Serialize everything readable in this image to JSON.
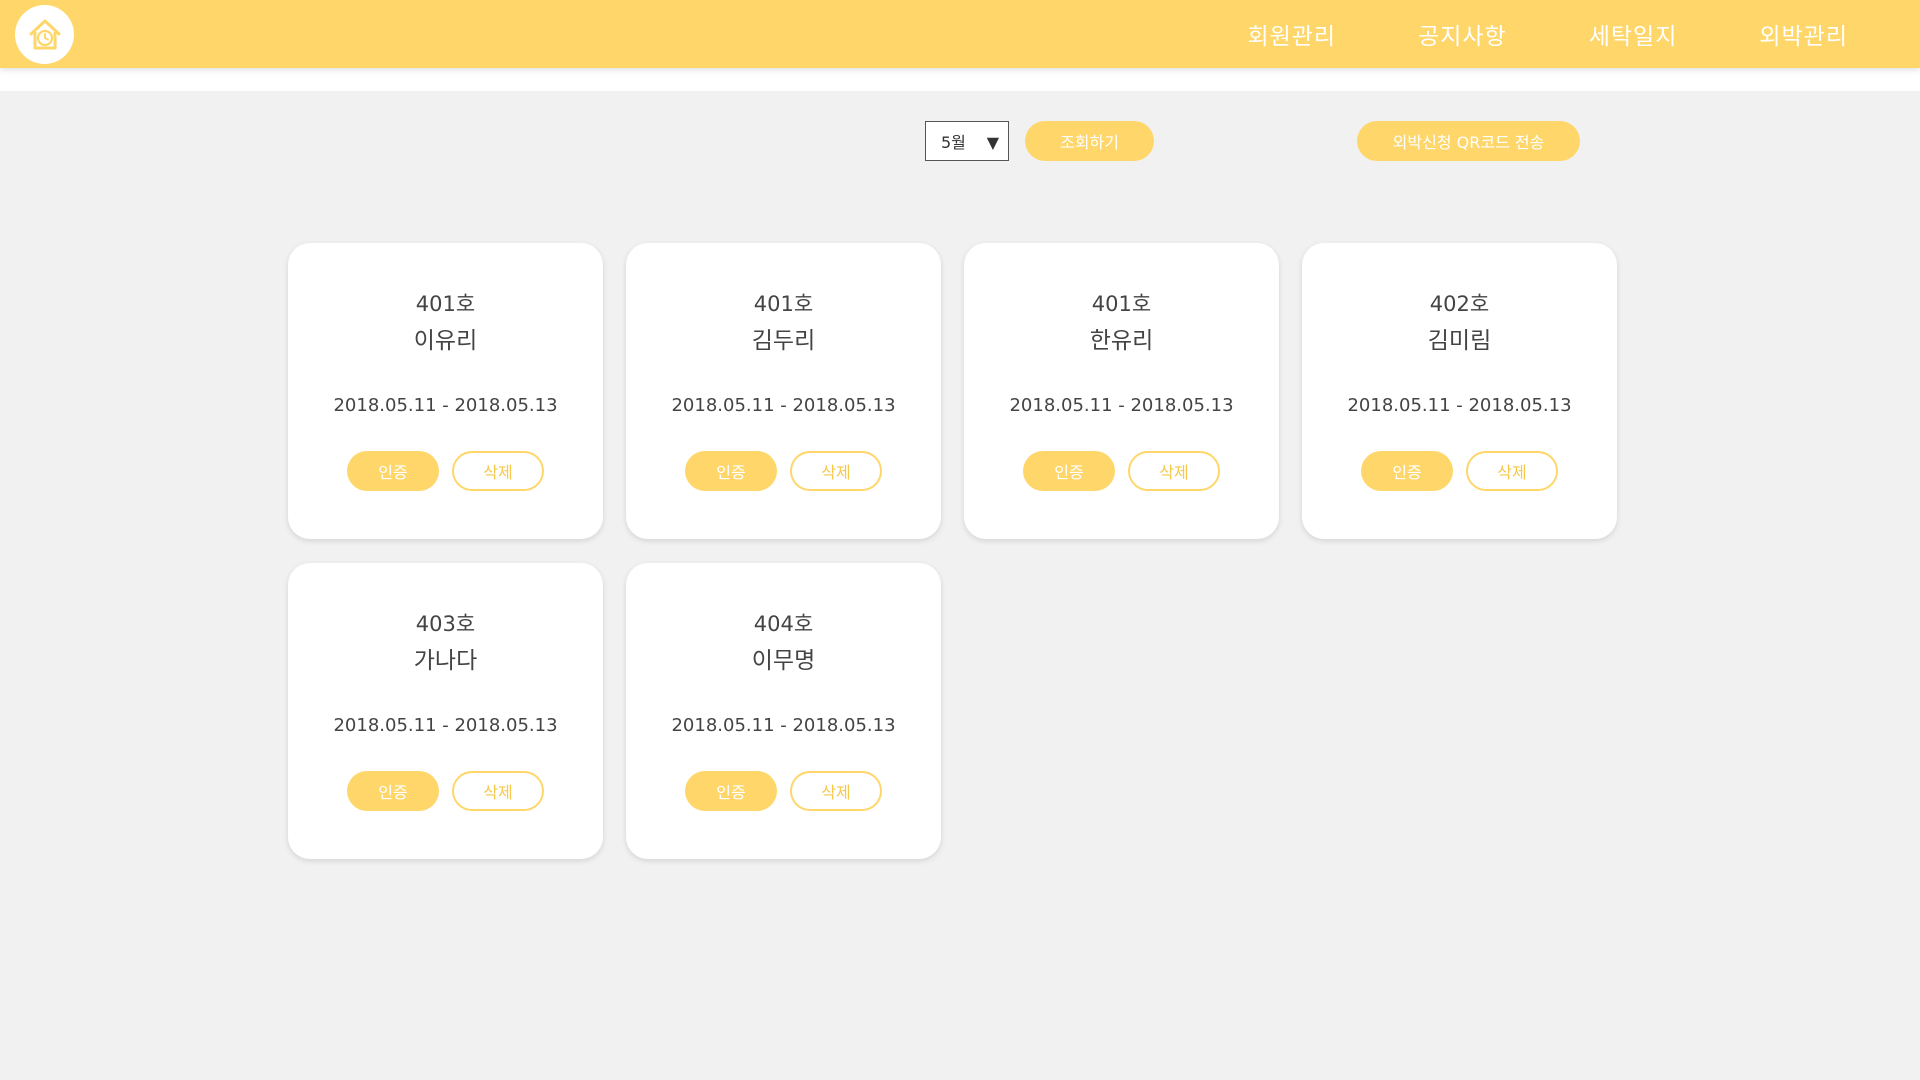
{
  "header": {
    "nav": [
      "회원관리",
      "공지사항",
      "세탁일지",
      "외박관리"
    ]
  },
  "controls": {
    "month": "5월",
    "search_label": "조회하기",
    "qr_label": "외박신청 QR코드 전송"
  },
  "cards": [
    {
      "room": "401호",
      "name": "이유리",
      "period": "2018.05.11 - 2018.05.13",
      "approve": "인증",
      "delete": "삭제"
    },
    {
      "room": "401호",
      "name": "김두리",
      "period": "2018.05.11 - 2018.05.13",
      "approve": "인증",
      "delete": "삭제"
    },
    {
      "room": "401호",
      "name": "한유리",
      "period": "2018.05.11 - 2018.05.13",
      "approve": "인증",
      "delete": "삭제"
    },
    {
      "room": "402호",
      "name": "김미림",
      "period": "2018.05.11 - 2018.05.13",
      "approve": "인증",
      "delete": "삭제"
    },
    {
      "room": "403호",
      "name": "가나다",
      "period": "2018.05.11 - 2018.05.13",
      "approve": "인증",
      "delete": "삭제"
    },
    {
      "room": "404호",
      "name": "이무명",
      "period": "2018.05.11 - 2018.05.13",
      "approve": "인증",
      "delete": "삭제"
    }
  ],
  "colors": {
    "accent": "#fed66a",
    "background": "#f1f1f1"
  }
}
